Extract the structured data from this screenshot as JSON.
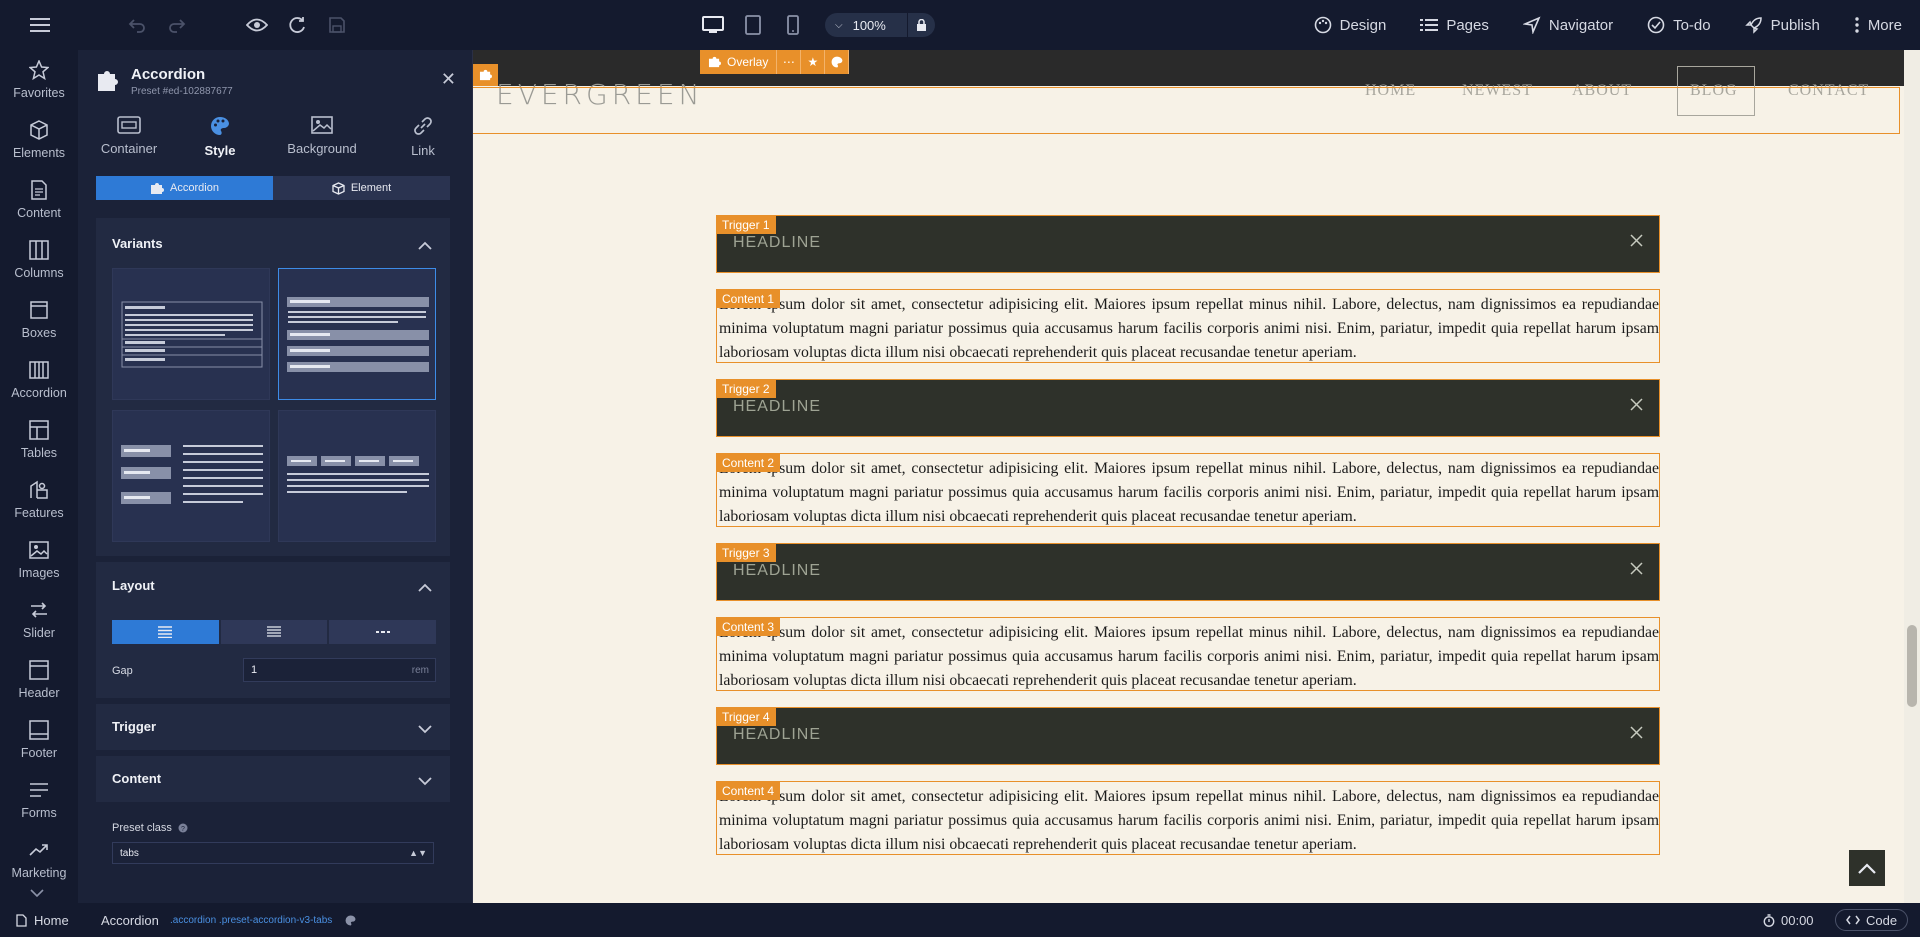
{
  "topbar": {
    "zoom": "100%",
    "nav": [
      {
        "label": "Design",
        "icon": "palette-icon"
      },
      {
        "label": "Pages",
        "icon": "list-icon"
      },
      {
        "label": "Navigator",
        "icon": "navigator-icon"
      },
      {
        "label": "To-do",
        "icon": "check-circle-icon"
      },
      {
        "label": "Publish",
        "icon": "rocket-icon"
      },
      {
        "label": "More",
        "icon": "dots-vertical-icon"
      }
    ]
  },
  "sidebar": {
    "items": [
      {
        "label": "Favorites",
        "icon": "star-icon"
      },
      {
        "label": "Elements",
        "icon": "cube-icon"
      },
      {
        "label": "Content",
        "icon": "document-icon"
      },
      {
        "label": "Columns",
        "icon": "columns-icon"
      },
      {
        "label": "Boxes",
        "icon": "box-icon"
      },
      {
        "label": "Accordion",
        "icon": "accordion-icon"
      },
      {
        "label": "Tables",
        "icon": "table-icon"
      },
      {
        "label": "Features",
        "icon": "features-icon"
      },
      {
        "label": "Images",
        "icon": "image-icon"
      },
      {
        "label": "Slider",
        "icon": "slider-icon"
      },
      {
        "label": "Header",
        "icon": "header-icon"
      },
      {
        "label": "Footer",
        "icon": "footer-icon"
      },
      {
        "label": "Forms",
        "icon": "forms-icon"
      },
      {
        "label": "Marketing",
        "icon": "chart-line-icon"
      }
    ]
  },
  "panel": {
    "title": "Accordion",
    "subtitle": "Preset #ed-102887677",
    "tabs": [
      {
        "label": "Container"
      },
      {
        "label": "Style"
      },
      {
        "label": "Background"
      },
      {
        "label": "Link"
      }
    ],
    "switch": {
      "accordion": "Accordion",
      "element": "Element"
    },
    "variants_title": "Variants",
    "layout_title": "Layout",
    "gap_label": "Gap",
    "gap_value": "1",
    "gap_unit": "rem",
    "trigger_title": "Trigger",
    "content_title": "Content",
    "preset_label": "Preset class",
    "preset_value": "tabs"
  },
  "canvas": {
    "overlay_label": "Overlay",
    "site": {
      "logo": "EVERGREEN",
      "menu": [
        "HOME",
        "NEWEST",
        "ABOUT",
        "BLOG",
        "CONTACT"
      ]
    },
    "accordion": [
      {
        "trigger_tag": "Trigger 1",
        "headline": "HEADLINE",
        "content_tag": "Content 1",
        "text": "Lorem ipsum dolor sit amet, consectetur adipisicing elit. Maiores ipsum repellat minus nihil. Labore, delectus, nam dignissimos ea repudiandae minima voluptatum magni pariatur possimus quia accusamus harum facilis corporis animi nisi. Enim, pariatur, impedit quia repellat harum ipsam laboriosam voluptas dicta illum nisi obcaecati reprehenderit quis placeat recusandae tenetur aperiam."
      },
      {
        "trigger_tag": "Trigger 2",
        "headline": "HEADLINE",
        "content_tag": "Content 2",
        "text": "Lorem ipsum dolor sit amet, consectetur adipisicing elit. Maiores ipsum repellat minus nihil. Labore, delectus, nam dignissimos ea repudiandae minima voluptatum magni pariatur possimus quia accusamus harum facilis corporis animi nisi. Enim, pariatur, impedit quia repellat harum ipsam laboriosam voluptas dicta illum nisi obcaecati reprehenderit quis placeat recusandae tenetur aperiam."
      },
      {
        "trigger_tag": "Trigger 3",
        "headline": "HEADLINE",
        "content_tag": "Content 3",
        "text": "Lorem ipsum dolor sit amet, consectetur adipisicing elit. Maiores ipsum repellat minus nihil. Labore, delectus, nam dignissimos ea repudiandae minima voluptatum magni pariatur possimus quia accusamus harum facilis corporis animi nisi. Enim, pariatur, impedit quia repellat harum ipsam laboriosam voluptas dicta illum nisi obcaecati reprehenderit quis placeat recusandae tenetur aperiam."
      },
      {
        "trigger_tag": "Trigger 4",
        "headline": "HEADLINE",
        "content_tag": "Content 4",
        "text": "Lorem ipsum dolor sit amet, consectetur adipisicing elit. Maiores ipsum repellat minus nihil. Labore, delectus, nam dignissimos ea repudiandae minima voluptatum magni pariatur possimus quia accusamus harum facilis corporis animi nisi. Enim, pariatur, impedit quia repellat harum ipsam laboriosam voluptas dicta illum nisi obcaecati reprehenderit quis placeat recusandae tenetur aperiam."
      }
    ]
  },
  "bottombar": {
    "home": "Home",
    "element": "Accordion",
    "classes": ".accordion .preset-accordion-v3-tabs",
    "time": "00:00",
    "code": "Code"
  },
  "colors": {
    "accent": "#2e7ad6",
    "selection": "#e8902a",
    "trigger_bg": "#2e312a",
    "page_bg": "#f7f2e7"
  }
}
